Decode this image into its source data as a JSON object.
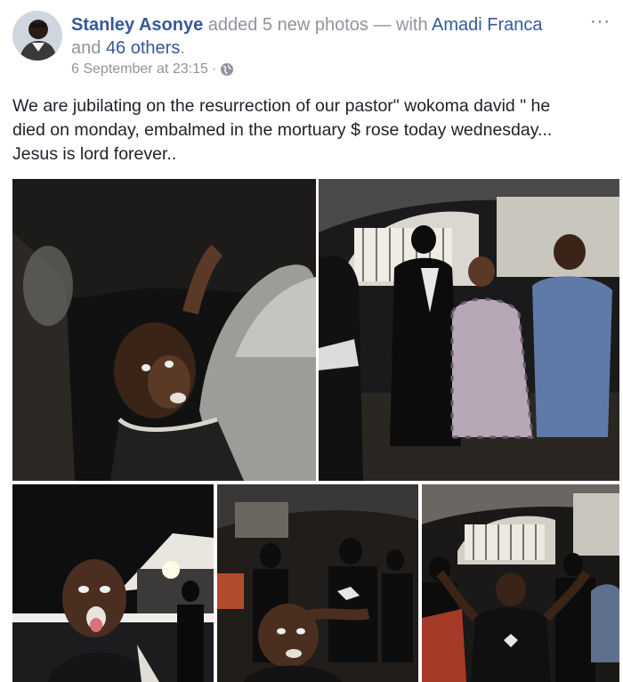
{
  "post": {
    "author": "Stanley Asonye",
    "action_text": " added 5 new photos — with ",
    "tagged_primary": "Amadi Franca",
    "and_text": " and ",
    "others_text": "46 others",
    "period": ".",
    "timestamp": "6 September at 23:15",
    "separator": "·",
    "privacy_icon": "globe-icon",
    "more_icon": "more-options-icon",
    "more_glyph": "···",
    "message": "We are jubilating on the resurrection of our pastor\" wokoma david \" he\ndied on monday, embalmed in the mortuary $ rose today wednesday...\nJesus is lord forever.."
  },
  "photos": [
    {
      "id": "photo-1",
      "icon": "photo-selfie-car"
    },
    {
      "id": "photo-2",
      "icon": "photo-crowd-gate"
    },
    {
      "id": "photo-3",
      "icon": "photo-selfie-tongue"
    },
    {
      "id": "photo-4",
      "icon": "photo-selfie-crowd"
    },
    {
      "id": "photo-5",
      "icon": "photo-crowd-dancing"
    }
  ],
  "colors": {
    "link": "#385898",
    "meta": "#90949c",
    "text": "#1d2129",
    "photo_bg": "#0b0b0c"
  }
}
